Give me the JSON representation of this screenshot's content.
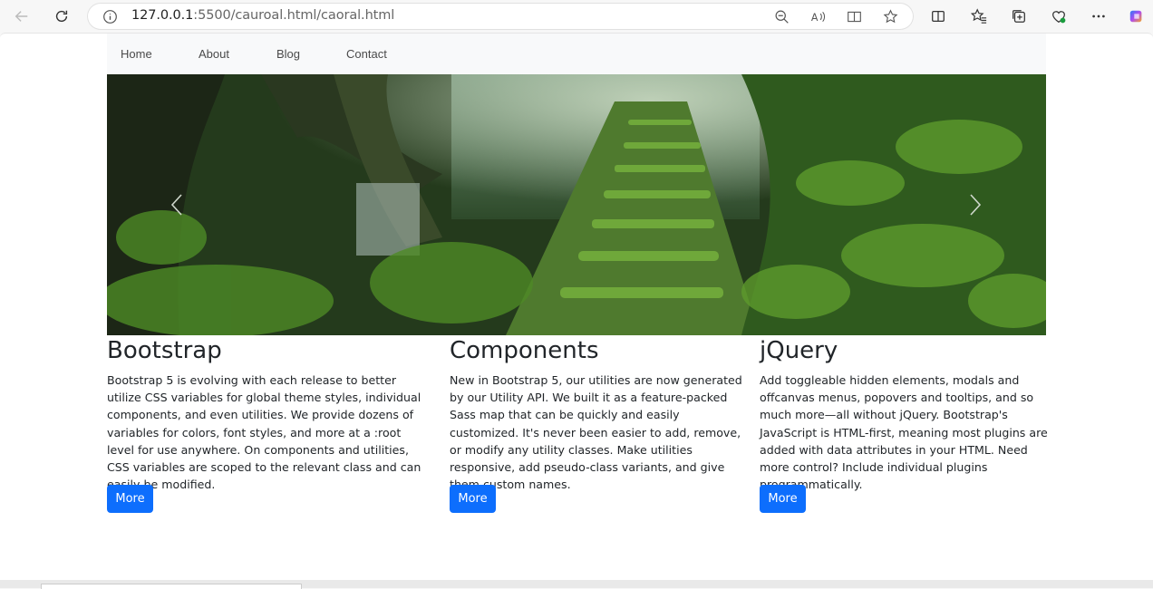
{
  "browser": {
    "url_host": "127.0.0.1",
    "url_rest": ":5500/cauroal.html/caoral.html",
    "icons": [
      "back-icon",
      "refresh-icon",
      "info-icon",
      "zoom-out-icon",
      "read-aloud-icon",
      "immersive-reader-icon",
      "favorite-star-icon",
      "split-screen-icon",
      "favorites-icon",
      "collections-icon",
      "browser-essentials-icon",
      "more-icon",
      "copilot-icon"
    ]
  },
  "navbar": {
    "items": [
      {
        "label": "Home"
      },
      {
        "label": "About"
      },
      {
        "label": "Blog"
      },
      {
        "label": "Contact"
      }
    ]
  },
  "carousel": {
    "image": "mossy stone stairs in forest",
    "prev_icon": "chevron-left-icon",
    "next_icon": "chevron-right-icon"
  },
  "columns": [
    {
      "title": "Bootstrap",
      "text": "Bootstrap 5 is evolving with each release to better utilize CSS variables for global theme styles, individual components, and even utilities. We provide dozens of variables for colors, font styles, and more at a :root level for use anywhere. On components and utilities, CSS variables are scoped to the relevant class and can easily be modified.",
      "button": "More"
    },
    {
      "title": "Components",
      "text": "New in Bootstrap 5, our utilities are now generated by our Utility API. We built it as a feature-packed Sass map that can be quickly and easily customized. It's never been easier to add, remove, or modify any utility classes. Make utilities responsive, add pseudo-class variants, and give them custom names.",
      "button": "More"
    },
    {
      "title": "jQuery",
      "text": "Add toggleable hidden elements, modals and offcanvas menus, popovers and tooltips, and so much more—all without jQuery. Bootstrap's JavaScript is HTML-first, meaning most plugins are added with data attributes in your HTML. Need more control? Include individual plugins programmatically.",
      "button": "More"
    }
  ],
  "colors": {
    "primary": "#0d6efd",
    "navbar_bg": "#f8f9fa",
    "text": "#212529"
  }
}
